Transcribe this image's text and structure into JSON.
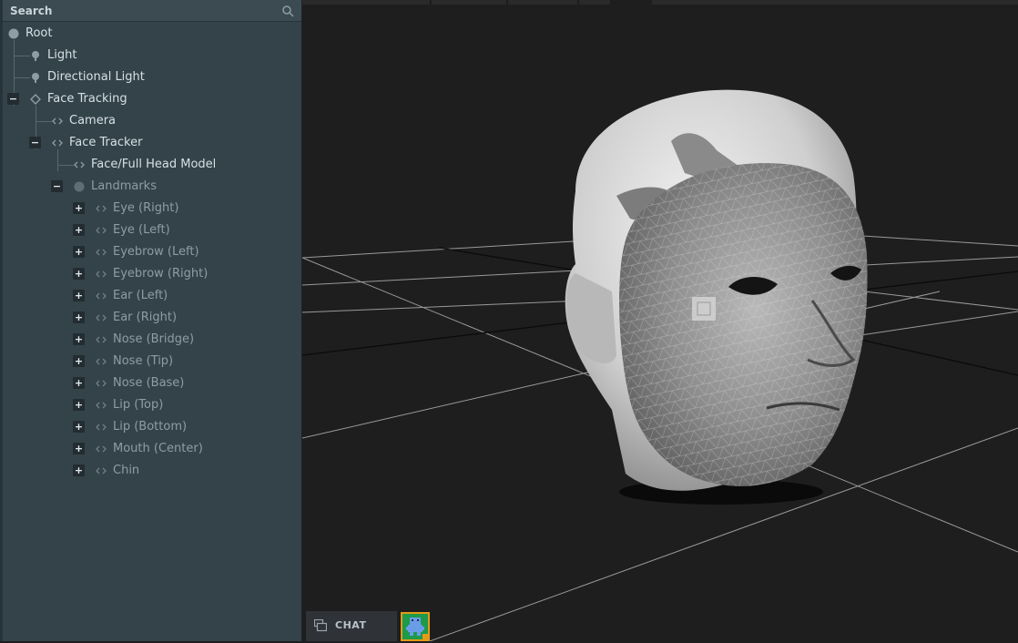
{
  "search": {
    "label": "Search"
  },
  "tree": {
    "root": "Root",
    "light": "Light",
    "directional_light": "Directional Light",
    "face_tracking": "Face Tracking",
    "camera": "Camera",
    "face_tracker": "Face Tracker",
    "head_model": "Face/Full Head Model",
    "landmarks": "Landmarks",
    "landmark_items": [
      "Eye (Right)",
      "Eye (Left)",
      "Eyebrow (Left)",
      "Eyebrow (Right)",
      "Ear (Left)",
      "Ear (Right)",
      "Nose (Bridge)",
      "Nose (Tip)",
      "Nose (Base)",
      "Lip (Top)",
      "Lip (Bottom)",
      "Mouth (Center)",
      "Chin"
    ],
    "expand_symbol": "+",
    "collapse_symbol": "−"
  },
  "chat": {
    "label": "CHAT"
  },
  "colors": {
    "panel": "#34434a",
    "viewport": "#1e1e1e",
    "accent_orange": "#e59a16",
    "avatar_green": "#1d9a4a"
  },
  "icons": [
    "search-icon",
    "circle-icon",
    "light-bulb-icon",
    "diamond-icon",
    "code-brackets-icon",
    "chat-icon",
    "avatar-icon"
  ]
}
